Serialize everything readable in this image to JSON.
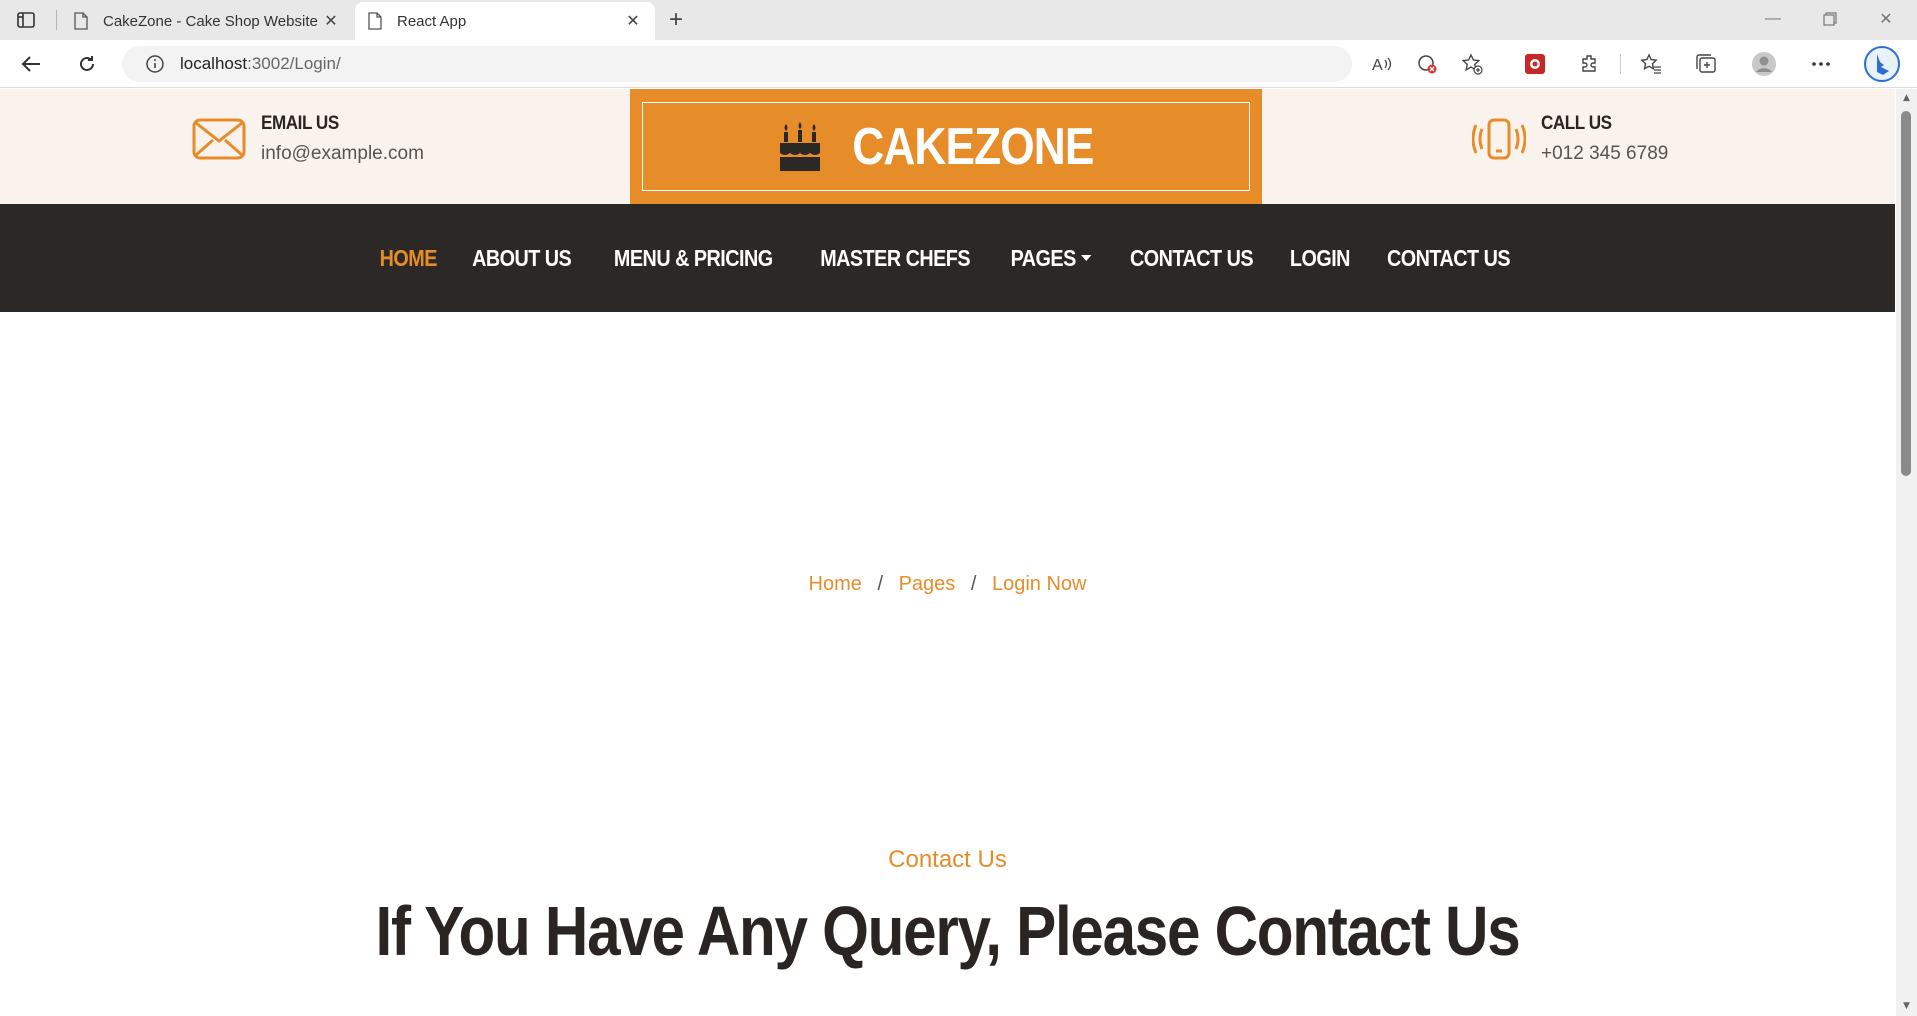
{
  "browser": {
    "tabs": [
      {
        "title": "CakeZone - Cake Shop Website T",
        "active": false
      },
      {
        "title": "React App",
        "active": true
      }
    ],
    "url_host": "localhost",
    "url_path": ":3002/Login/"
  },
  "topbar": {
    "email": {
      "heading": "EMAIL US",
      "value": "info@example.com"
    },
    "call": {
      "heading": "CALL US",
      "value": "+012 345 6789"
    },
    "logo": "CAKEZONE"
  },
  "nav": {
    "items": [
      {
        "label": "HOME",
        "active": true
      },
      {
        "label": "ABOUT US"
      },
      {
        "label": "MENU & PRICING"
      },
      {
        "label": "MASTER CHEFS"
      },
      {
        "label": "PAGES",
        "dropdown": true
      },
      {
        "label": "CONTACT US"
      },
      {
        "label": "LOGIN"
      },
      {
        "label": "CONTACT US"
      }
    ]
  },
  "breadcrumb": {
    "home": "Home",
    "pages": "Pages",
    "current": "Login Now",
    "separator": "/"
  },
  "section": {
    "subtitle": "Contact Us",
    "title": "If You Have Any Query, Please Contact Us"
  },
  "colors": {
    "accent": "#e68d2a",
    "dark": "#2c2826",
    "topbar_bg": "#faf3ed"
  }
}
